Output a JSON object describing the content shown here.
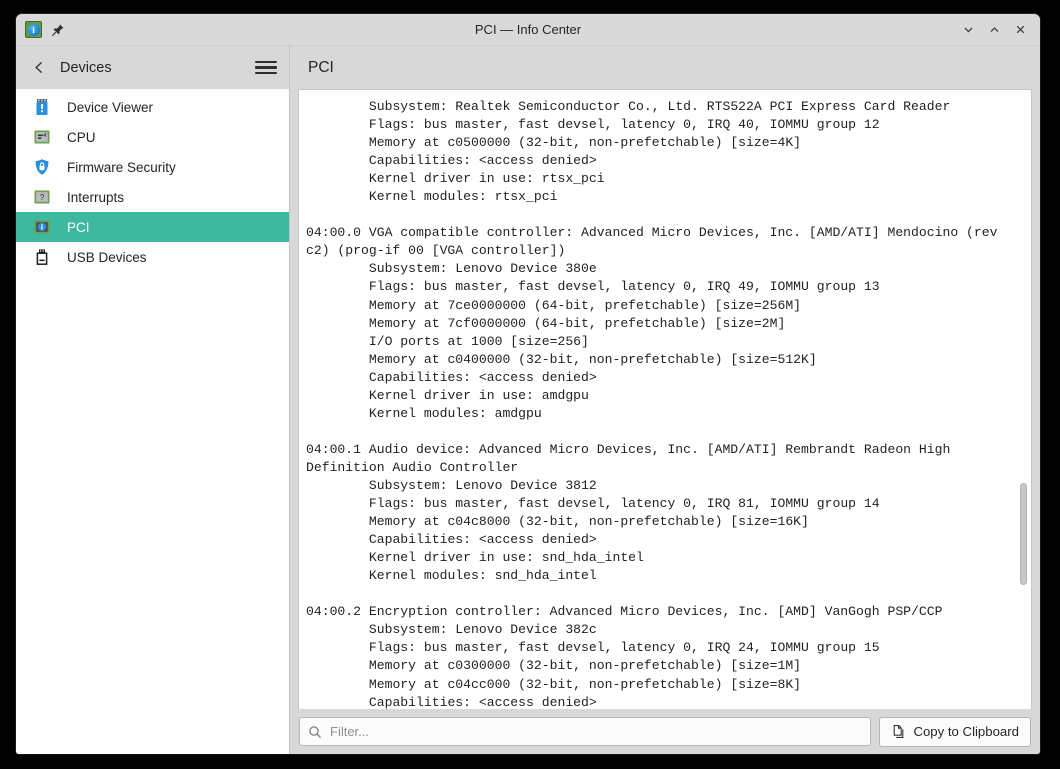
{
  "window": {
    "title": "PCI — Info Center",
    "app_icon": "info-center-icon",
    "pin_icon": "pin-icon",
    "buttons": [
      {
        "name": "minimize-button",
        "icon": "chevron-down-icon"
      },
      {
        "name": "maximize-button",
        "icon": "chevron-up-icon"
      },
      {
        "name": "close-button",
        "icon": "close-icon"
      }
    ]
  },
  "sidebar": {
    "back_icon": "chevron-left-icon",
    "title": "Devices",
    "menu_icon": "hamburger-menu-icon",
    "items": [
      {
        "label": "Device Viewer",
        "icon": "device-viewer-icon",
        "active": false
      },
      {
        "label": "CPU",
        "icon": "cpu-chip-icon",
        "active": false
      },
      {
        "label": "Firmware Security",
        "icon": "shield-icon",
        "active": false
      },
      {
        "label": "Interrupts",
        "icon": "interrupts-chip-icon",
        "active": false
      },
      {
        "label": "PCI",
        "icon": "pci-info-icon",
        "active": true
      },
      {
        "label": "USB Devices",
        "icon": "usb-stick-icon",
        "active": false
      }
    ]
  },
  "main": {
    "header_title": "PCI",
    "content": "        Subsystem: Realtek Semiconductor Co., Ltd. RTS522A PCI Express Card Reader\n        Flags: bus master, fast devsel, latency 0, IRQ 40, IOMMU group 12\n        Memory at c0500000 (32-bit, non-prefetchable) [size=4K]\n        Capabilities: <access denied>\n        Kernel driver in use: rtsx_pci\n        Kernel modules: rtsx_pci\n\n04:00.0 VGA compatible controller: Advanced Micro Devices, Inc. [AMD/ATI] Mendocino (rev c2) (prog-if 00 [VGA controller])\n        Subsystem: Lenovo Device 380e\n        Flags: bus master, fast devsel, latency 0, IRQ 49, IOMMU group 13\n        Memory at 7ce0000000 (64-bit, prefetchable) [size=256M]\n        Memory at 7cf0000000 (64-bit, prefetchable) [size=2M]\n        I/O ports at 1000 [size=256]\n        Memory at c0400000 (32-bit, non-prefetchable) [size=512K]\n        Capabilities: <access denied>\n        Kernel driver in use: amdgpu\n        Kernel modules: amdgpu\n\n04:00.1 Audio device: Advanced Micro Devices, Inc. [AMD/ATI] Rembrandt Radeon High Definition Audio Controller\n        Subsystem: Lenovo Device 3812\n        Flags: bus master, fast devsel, latency 0, IRQ 81, IOMMU group 14\n        Memory at c04c8000 (32-bit, non-prefetchable) [size=16K]\n        Capabilities: <access denied>\n        Kernel driver in use: snd_hda_intel\n        Kernel modules: snd_hda_intel\n\n04:00.2 Encryption controller: Advanced Micro Devices, Inc. [AMD] VanGogh PSP/CCP\n        Subsystem: Lenovo Device 382c\n        Flags: bus master, fast devsel, latency 0, IRQ 24, IOMMU group 15\n        Memory at c0300000 (32-bit, non-prefetchable) [size=1M]\n        Memory at c04cc000 (32-bit, non-prefetchable) [size=8K]\n        Capabilities: <access denied>",
    "scrollbar": {
      "name": "vertical-scrollbar",
      "thumb_top_pct": 63.5,
      "thumb_height_pct": 16.5
    }
  },
  "bottom_bar": {
    "filter_placeholder": "Filter...",
    "filter_value": "",
    "filter_icon": "search-icon",
    "copy_label": "Copy to Clipboard",
    "copy_icon": "copy-icon"
  },
  "colors": {
    "accent": "#3fb8a0",
    "window_bg": "#d8d8d8",
    "content_bg": "#ffffff",
    "text": "#232629"
  }
}
